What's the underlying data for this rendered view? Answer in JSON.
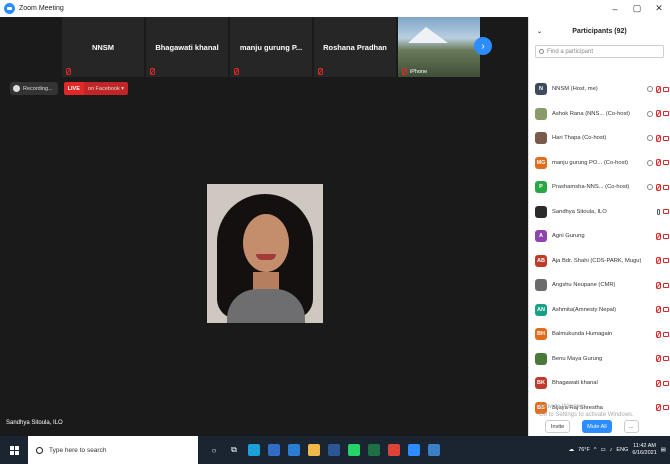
{
  "window": {
    "title": "Zoom Meeting",
    "controls": [
      "–",
      "▢",
      "✕"
    ]
  },
  "gallery": {
    "tiles": [
      {
        "name": "NNSM"
      },
      {
        "name": "Bhagawati khanal"
      },
      {
        "name": "manju gurung P..."
      },
      {
        "name": "Roshana Pradhan"
      },
      {
        "name": "iPhone"
      }
    ],
    "next_label": "›"
  },
  "recording": {
    "label": "Recording...",
    "live_label": "LIVE",
    "live_target": "on Facebook ▾"
  },
  "speaker": {
    "name": "Sandhya Sitoula, ILO"
  },
  "participants": {
    "header": "Participants (92)",
    "collapse": "⌄",
    "search_placeholder": "Find a participant",
    "list": [
      {
        "initials": "N",
        "color": "#3d4a5c",
        "name": "NNSM (Host, me)"
      },
      {
        "initials": "",
        "color": "#8a9b6a",
        "name": "Ashok Rana (NNS... (Co-host)"
      },
      {
        "initials": "",
        "color": "#7a5a4a",
        "name": "Hari Thapa (Co-host)"
      },
      {
        "initials": "MG",
        "color": "#e36c1c",
        "name": "manju gurung PO... (Co-host)"
      },
      {
        "initials": "P",
        "color": "#28a745",
        "name": "Prashamsha-NNS... (Co-host)"
      },
      {
        "initials": "",
        "color": "#2a2a2a",
        "name": "Sandhya Sitoula, ILO"
      },
      {
        "initials": "A",
        "color": "#8e44ad",
        "name": "Agni Gurung"
      },
      {
        "initials": "AB",
        "color": "#c0392b",
        "name": "Aja Bdr. Shahi (CDS-PARK, Mugu)"
      },
      {
        "initials": "",
        "color": "#6b6b6b",
        "name": "Angshu Neupane (CMR)"
      },
      {
        "initials": "AN",
        "color": "#16a085",
        "name": "Ashmita(Amnesty Nepal)"
      },
      {
        "initials": "BH",
        "color": "#e36c1c",
        "name": "Balmukunda Humagain"
      },
      {
        "initials": "",
        "color": "#4a7a3a",
        "name": "Benu Maya Gurung"
      },
      {
        "initials": "BK",
        "color": "#c0392b",
        "name": "Bhagawati khanal"
      },
      {
        "initials": "BS",
        "color": "#e36c1c",
        "name": "Bijaya Raj Shrestha"
      }
    ],
    "watermark_line1": "Activate Windows",
    "watermark_line2": "Go to Settings to activate Windows.",
    "invite": "Invite",
    "mute_all": "Mute All",
    "more": "..."
  },
  "taskbar": {
    "search_placeholder": "Type here to search",
    "temp": "76°F",
    "lang": "ENG",
    "time": "11:42 AM",
    "date": "6/16/2021"
  }
}
